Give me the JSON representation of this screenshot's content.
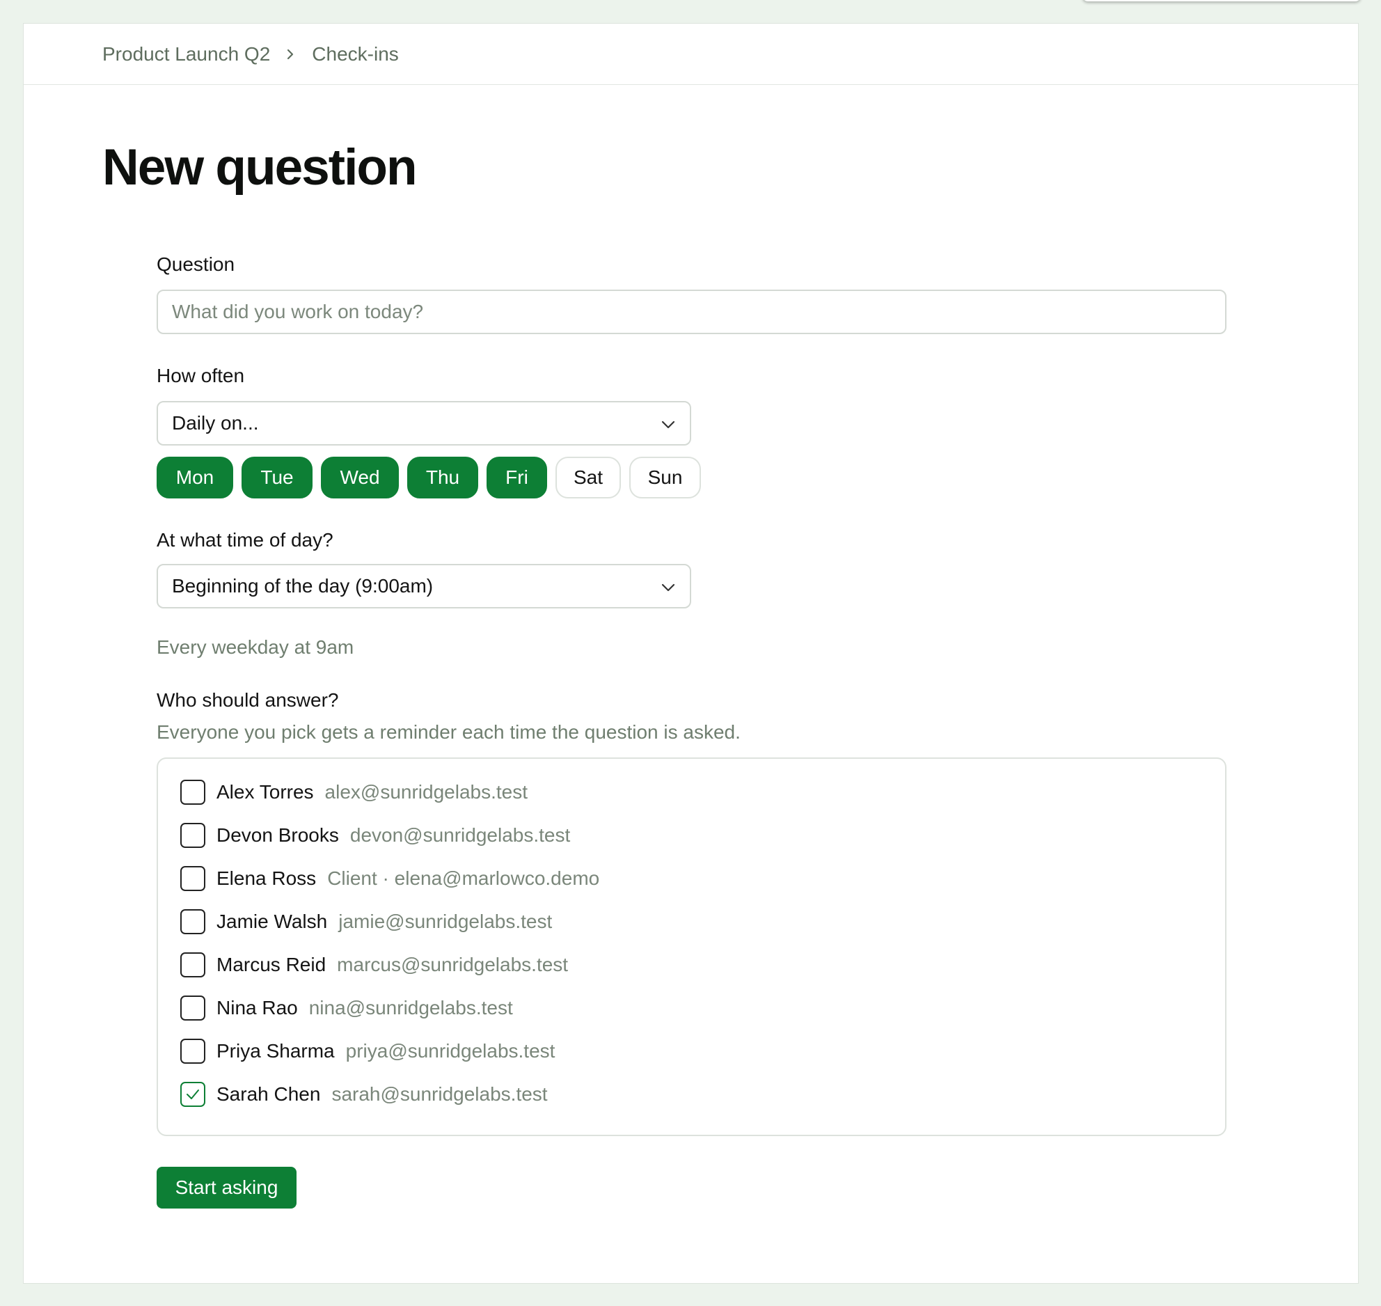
{
  "breadcrumb": {
    "project": "Product Launch Q2",
    "section": "Check-ins"
  },
  "page": {
    "title": "New question"
  },
  "question": {
    "label": "Question",
    "value": "",
    "placeholder": "What did you work on today?"
  },
  "frequency": {
    "label": "How often",
    "selected": "Daily on...",
    "days": [
      {
        "label": "Mon",
        "selected": true
      },
      {
        "label": "Tue",
        "selected": true
      },
      {
        "label": "Wed",
        "selected": true
      },
      {
        "label": "Thu",
        "selected": true
      },
      {
        "label": "Fri",
        "selected": true
      },
      {
        "label": "Sat",
        "selected": false
      },
      {
        "label": "Sun",
        "selected": false
      }
    ]
  },
  "time": {
    "label": "At what time of day?",
    "selected": "Beginning of the day (9:00am)",
    "summary": "Every weekday at 9am"
  },
  "answerers": {
    "label": "Who should answer?",
    "hint": "Everyone you pick gets a reminder each time the question is asked.",
    "people": [
      {
        "name": "Alex Torres",
        "detail": "alex@sunridgelabs.test",
        "checked": false
      },
      {
        "name": "Devon Brooks",
        "detail": "devon@sunridgelabs.test",
        "checked": false
      },
      {
        "name": "Elena Ross",
        "detail": "Client · elena@marlowco.demo",
        "checked": false
      },
      {
        "name": "Jamie Walsh",
        "detail": "jamie@sunridgelabs.test",
        "checked": false
      },
      {
        "name": "Marcus Reid",
        "detail": "marcus@sunridgelabs.test",
        "checked": false
      },
      {
        "name": "Nina Rao",
        "detail": "nina@sunridgelabs.test",
        "checked": false
      },
      {
        "name": "Priya Sharma",
        "detail": "priya@sunridgelabs.test",
        "checked": false
      },
      {
        "name": "Sarah Chen",
        "detail": "sarah@sunridgelabs.test",
        "checked": true
      }
    ]
  },
  "submit": {
    "label": "Start asking"
  },
  "colors": {
    "accent": "#0d7f35",
    "background": "#ecf3ec",
    "muted_text": "#6f7e6f"
  },
  "icons": {
    "breadcrumb_separator": "chevron-right-icon",
    "select_arrow": "chevron-down-icon",
    "checkmark": "check-icon"
  }
}
